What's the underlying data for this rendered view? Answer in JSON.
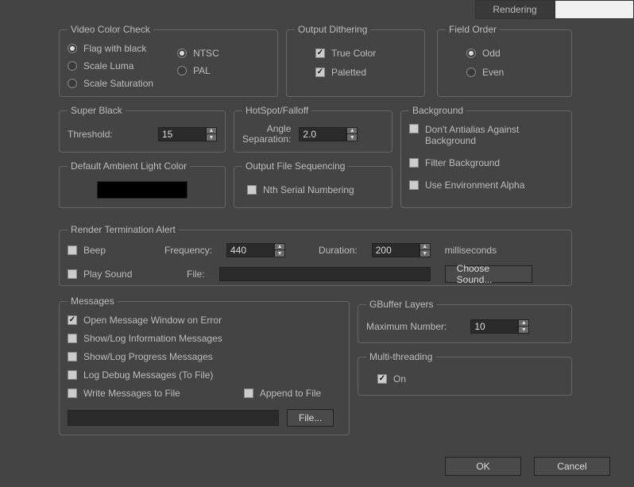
{
  "tabs": {
    "rendering": "Rendering",
    "other": ""
  },
  "video_color_check": {
    "legend": "Video Color Check",
    "flag_black": "Flag with black",
    "scale_luma": "Scale Luma",
    "scale_sat": "Scale Saturation",
    "ntsc": "NTSC",
    "pal": "PAL"
  },
  "output_dithering": {
    "legend": "Output Dithering",
    "true_color": "True Color",
    "paletted": "Paletted"
  },
  "field_order": {
    "legend": "Field Order",
    "odd": "Odd",
    "even": "Even"
  },
  "super_black": {
    "legend": "Super Black",
    "threshold_label": "Threshold:",
    "threshold_value": "15"
  },
  "hotspot": {
    "legend": "HotSpot/Falloff",
    "angle_sep_label1": "Angle",
    "angle_sep_label2": "Separation:",
    "angle_sep_value": "2.0"
  },
  "background": {
    "legend": "Background",
    "dont_aa": "Don't Antialias Against Background",
    "filter_bg": "Filter Background",
    "use_env": "Use Environment Alpha"
  },
  "ambient": {
    "legend": "Default Ambient Light Color",
    "color": "#000000"
  },
  "ofs": {
    "legend": "Output File Sequencing",
    "nth": "Nth Serial Numbering"
  },
  "rta": {
    "legend": "Render Termination Alert",
    "beep": "Beep",
    "play_sound": "Play Sound",
    "freq_label": "Frequency:",
    "freq_value": "440",
    "duration_label": "Duration:",
    "duration_value": "200",
    "ms": "milliseconds",
    "file_label": "File:",
    "file_value": "",
    "choose": "Choose Sound..."
  },
  "messages": {
    "legend": "Messages",
    "open_on_err": "Open Message Window on Error",
    "show_info": "Show/Log Information Messages",
    "show_prog": "Show/Log Progress Messages",
    "log_debug": "Log Debug Messages (To File)",
    "write_to_file": "Write Messages to File",
    "append": "Append to File",
    "file_btn": "File...",
    "path_value": ""
  },
  "gbuffer": {
    "legend": "GBuffer Layers",
    "max_label": "Maximum Number:",
    "max_value": "10"
  },
  "mt": {
    "legend": "Multi-threading",
    "on": "On"
  },
  "footer": {
    "ok": "OK",
    "cancel": "Cancel"
  }
}
